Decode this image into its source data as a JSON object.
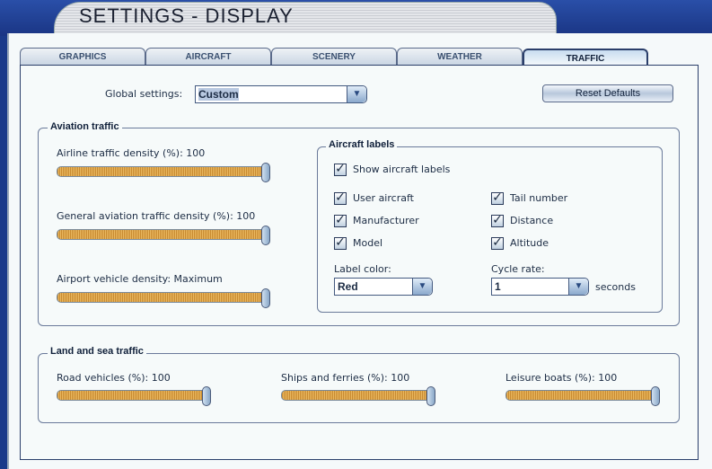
{
  "window": {
    "title": "SETTINGS - DISPLAY"
  },
  "tabs": [
    {
      "label": "GRAPHICS"
    },
    {
      "label": "AIRCRAFT"
    },
    {
      "label": "SCENERY"
    },
    {
      "label": "WEATHER"
    },
    {
      "label": "TRAFFIC",
      "active": true
    }
  ],
  "global": {
    "label": "Global settings:",
    "value": "Custom",
    "reset_label": "Reset Defaults"
  },
  "aviation": {
    "title": "Aviation traffic",
    "sliders": [
      {
        "label": "Airline traffic density (%): 100",
        "value_percent": 100
      },
      {
        "label": "General aviation traffic density (%): 100",
        "value_percent": 100
      },
      {
        "label": "Airport vehicle density: Maximum",
        "value_percent": 100
      }
    ]
  },
  "labels": {
    "title": "Aircraft labels",
    "show": {
      "label": "Show aircraft labels",
      "checked": true
    },
    "options": [
      {
        "label": "User aircraft",
        "checked": true
      },
      {
        "label": "Tail number",
        "checked": true
      },
      {
        "label": "Manufacturer",
        "checked": true
      },
      {
        "label": "Distance",
        "checked": true
      },
      {
        "label": "Model",
        "checked": true
      },
      {
        "label": "Altitude",
        "checked": true
      }
    ],
    "color_label": "Label color:",
    "color_value": "Red",
    "cycle_label": "Cycle rate:",
    "cycle_value": "1",
    "cycle_unit": "seconds"
  },
  "land_sea": {
    "title": "Land and sea traffic",
    "sliders": [
      {
        "label": "Road vehicles (%): 100",
        "value_percent": 100
      },
      {
        "label": "Ships and ferries (%): 100",
        "value_percent": 100
      },
      {
        "label": "Leisure boats (%): 100",
        "value_percent": 100
      }
    ]
  }
}
